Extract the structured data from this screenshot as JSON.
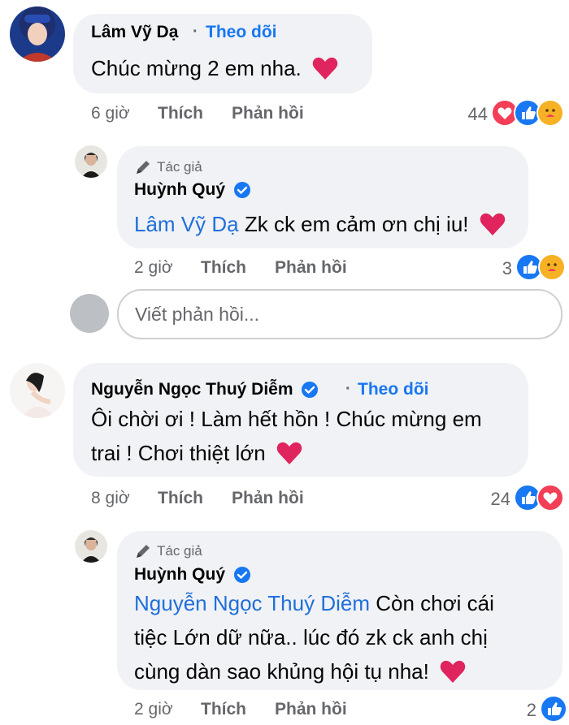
{
  "comments": [
    {
      "name": "Lâm Vỹ Dạ",
      "follow": "Theo dõi",
      "text": "Chúc mừng 2 em nha.",
      "time": "6 giờ",
      "like": "Thích",
      "reply": "Phản hồi",
      "reaction_count": "44",
      "reply_item": {
        "author_label": "Tác giả",
        "name": "Huỳnh Quý",
        "mention": "Lâm Vỹ Dạ",
        "text": " Zk ck em cảm ơn chị iu!",
        "time": "2 giờ",
        "like": "Thích",
        "reply": "Phản hồi",
        "reaction_count": "3"
      }
    },
    {
      "name": "Nguyễn Ngọc Thuý Diễm",
      "follow": "Theo dõi",
      "text_line1": "Ôi chời ơi ! Làm hết hồn ! Chúc mừng em",
      "text_line2": "trai ! Chơi thiệt lớn",
      "time": "8 giờ",
      "like": "Thích",
      "reply": "Phản hồi",
      "reaction_count": "24",
      "reply_item": {
        "author_label": "Tác giả",
        "name": "Huỳnh Quý",
        "mention": "Nguyễn Ngọc Thuý Diễm",
        "text_line1": " Còn chơi cái",
        "text_line2": "tiệc Lớn dữ nữa.. lúc đó zk ck anh chị",
        "text_line3": "cùng dàn sao khủng hội tụ nha!",
        "time": "2 giờ",
        "like": "Thích",
        "reply": "Phản hồi",
        "reaction_count": "2"
      }
    }
  ],
  "reply_input": {
    "placeholder": "Viết phản hồi..."
  },
  "colors": {
    "accent": "#1877f2",
    "bubble": "#f0f2f5",
    "heart": "#e0245e",
    "muted": "#65676b"
  },
  "icons": [
    "heart-icon",
    "like-reaction-icon",
    "love-reaction-icon",
    "care-reaction-icon",
    "pen-icon",
    "verified-badge-icon"
  ]
}
